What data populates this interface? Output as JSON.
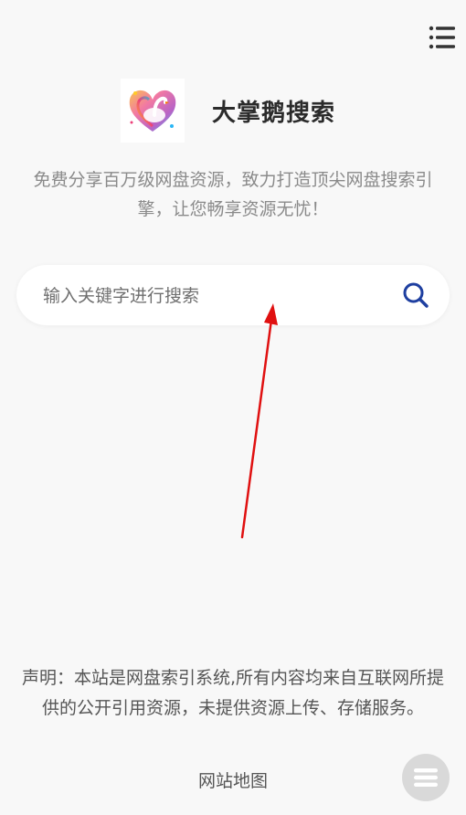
{
  "header": {
    "menu_icon": "hamburger-menu-icon"
  },
  "brand": {
    "logo_icon": "swan-heart-logo",
    "title": "大掌鹅搜索"
  },
  "tagline": "免费分享百万级网盘资源，致力打造顶尖网盘搜索引擎，让您畅享资源无忧！",
  "search": {
    "placeholder": "输入关键字进行搜索",
    "value": "",
    "icon": "search-icon",
    "accent_color": "#1e3fa0"
  },
  "annotation": {
    "arrow_color": "#e01010"
  },
  "footer": {
    "disclaimer": "声明：本站是网盘索引系统,所有内容均来自互联网所提供的公开引用资源，未提供资源上传、存储服务。",
    "sitemap_label": "网站地图",
    "float_button_icon": "menu-lines-icon"
  }
}
